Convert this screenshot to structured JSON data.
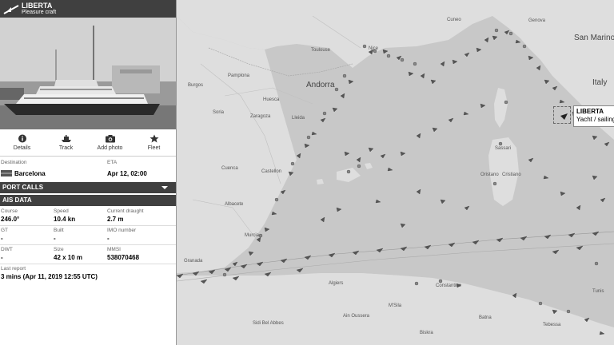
{
  "vessel": {
    "name": "LIBERTA",
    "type": "Pleasure craft",
    "tooltip_type": "Yacht / sailing vessel"
  },
  "actions": [
    {
      "label": "Details",
      "icon": "info-icon"
    },
    {
      "label": "Track",
      "icon": "ship-track-icon"
    },
    {
      "label": "Add photo",
      "icon": "camera-icon"
    },
    {
      "label": "Fleet",
      "icon": "star-icon"
    }
  ],
  "voyage": {
    "destination_label": "Destination",
    "destination": "Barcelona",
    "eta_label": "ETA",
    "eta": "Apr 12, 02:00"
  },
  "port_calls": {
    "label": "PORT CALLS"
  },
  "ais": {
    "label": "AIS DATA",
    "course_label": "Course",
    "course": "246.0°",
    "speed_label": "Speed",
    "speed": "10.4 kn",
    "draught_label": "Current draught",
    "draught": "2.7 m",
    "gt_label": "GT",
    "gt": "-",
    "built_label": "Built",
    "built": "-",
    "imo_label": "IMO number",
    "imo": "-",
    "dwt_label": "DWT",
    "dwt": "-",
    "size_label": "Size",
    "size": "42 x 10 m",
    "mmsi_label": "MMSI",
    "mmsi": "538070468",
    "last_report_label": "Last report",
    "last_report": "3 mins (Apr 11, 2019 12:55 UTC)"
  },
  "map": {
    "countries": [
      {
        "name": "Andorra",
        "id": "andorra"
      },
      {
        "name": "Italy",
        "id": "italy"
      },
      {
        "name": "San Marino",
        "id": "sanmarino"
      }
    ],
    "cities": [
      "Toulouse",
      "Pamplona",
      "Huesca",
      "Soria",
      "Zaragoza",
      "Lleida",
      "Burgos",
      "Cuenca",
      "Castellon",
      "Albacete",
      "Murcia",
      "Granada",
      "Algiers",
      "Constantine",
      "Sidi Bel Abbes",
      "Ain Oussera",
      "M'Sila",
      "Biskra",
      "Sassari",
      "Oristano",
      "Cristiano",
      "Genova",
      "Cuneo",
      "Nice",
      "Tunis",
      "Batna",
      "Tebessa"
    ]
  }
}
